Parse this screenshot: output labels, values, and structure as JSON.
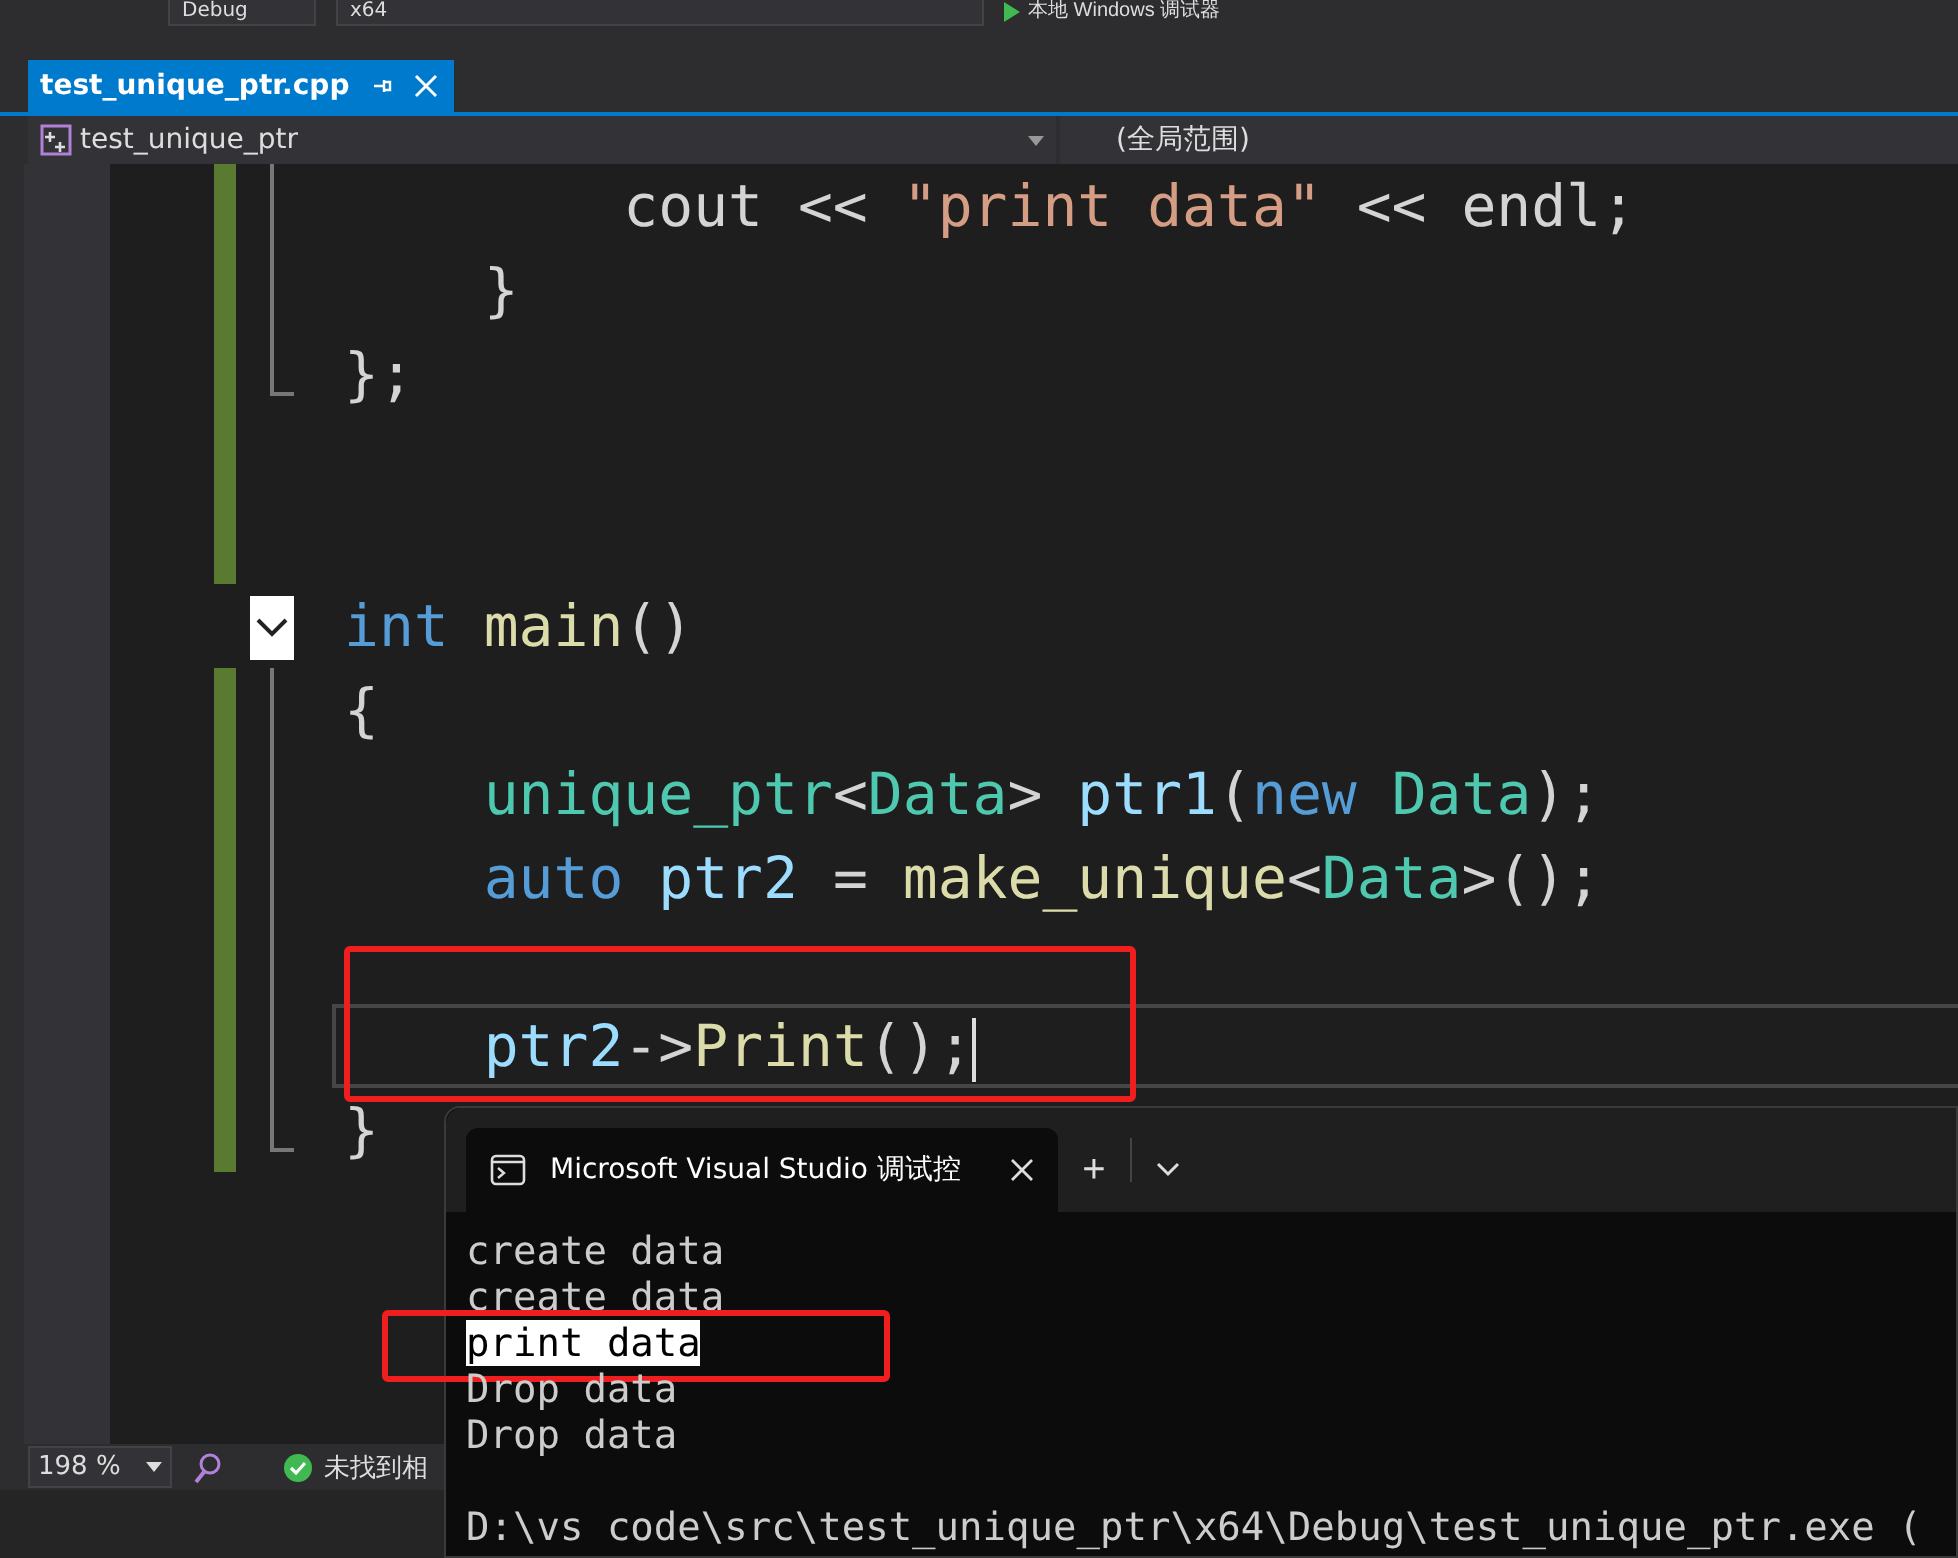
{
  "toolbar": {
    "items": [
      {
        "kind": "combo",
        "label": "Debug"
      },
      {
        "kind": "combo",
        "label": "x64"
      },
      {
        "kind": "run",
        "label": "本地 Windows 调试器"
      }
    ]
  },
  "tabs": [
    {
      "label": "test_unique_ptr.cpp",
      "selected": true
    }
  ],
  "nav": {
    "scope": "test_unique_ptr",
    "member": "(全局范围)"
  },
  "code_lines": [
    {
      "kind": "body",
      "changed": true,
      "tokens": [
        {
          "text": "        cout << ",
          "kind": "plain"
        },
        {
          "text": "\"print data\"",
          "kind": "string"
        },
        {
          "text": " << endl;",
          "kind": "plain"
        }
      ]
    },
    {
      "kind": "body",
      "changed": true,
      "tokens": [
        {
          "text": "    }",
          "kind": "plain"
        }
      ]
    },
    {
      "kind": "end",
      "changed": true,
      "tokens": [
        {
          "text": "};",
          "kind": "plain"
        }
      ]
    },
    {
      "kind": "blank",
      "changed": true
    },
    {
      "kind": "blank",
      "changed": true
    },
    {
      "kind": "start",
      "changed": false,
      "expanded": true,
      "tokens": [
        {
          "text": "int ",
          "kind": "keyword"
        },
        {
          "text": "main",
          "kind": "function"
        },
        {
          "text": "()",
          "kind": "plain"
        }
      ]
    },
    {
      "kind": "body",
      "changed": true,
      "tokens": [
        {
          "text": "{",
          "kind": "plain"
        }
      ]
    },
    {
      "kind": "body",
      "changed": true,
      "tokens": [
        {
          "text": "    unique_ptr",
          "kind": "type"
        },
        {
          "text": "<",
          "kind": "plain"
        },
        {
          "text": "Data",
          "kind": "type"
        },
        {
          "text": "> ",
          "kind": "plain"
        },
        {
          "text": "ptr1",
          "kind": "variable"
        },
        {
          "text": "(",
          "kind": "plain"
        },
        {
          "text": "new ",
          "kind": "keyword"
        },
        {
          "text": "Data",
          "kind": "type"
        },
        {
          "text": ");",
          "kind": "plain"
        }
      ]
    },
    {
      "kind": "body",
      "changed": true,
      "tokens": [
        {
          "text": "    auto ",
          "kind": "keyword"
        },
        {
          "text": "ptr2",
          "kind": "variable"
        },
        {
          "text": " = ",
          "kind": "plain"
        },
        {
          "text": "make_unique",
          "kind": "function"
        },
        {
          "text": "<",
          "kind": "plain"
        },
        {
          "text": "Data",
          "kind": "type"
        },
        {
          "text": ">();",
          "kind": "plain"
        }
      ]
    },
    {
      "kind": "body",
      "changed": true
    },
    {
      "kind": "body",
      "changed": true,
      "current": true,
      "circled": true,
      "tokens": [
        {
          "text": "    ptr2",
          "kind": "variable"
        },
        {
          "text": "->",
          "kind": "plain"
        },
        {
          "text": "Print",
          "kind": "function"
        },
        {
          "text": "();",
          "kind": "plain"
        }
      ]
    },
    {
      "kind": "end",
      "changed": true,
      "tokens": [
        {
          "text": "}",
          "kind": "plain"
        }
      ]
    }
  ],
  "status_bar": {
    "zoom": "198 %",
    "message": "未找到相"
  },
  "console": {
    "tab_title": "Microsoft Visual Studio 调试控",
    "new_tab": "+",
    "lines": [
      {
        "text": "create data",
        "selected": false
      },
      {
        "text": "create data",
        "selected": false
      },
      {
        "text": "print data",
        "selected": true,
        "circled": true
      },
      {
        "text": "Drop data",
        "selected": false
      },
      {
        "text": "Drop data",
        "selected": false
      },
      {
        "text": "D:\\vs code\\src\\test_unique_ptr\\x64\\Debug\\test_unique_ptr.exe (",
        "selected": false
      }
    ]
  }
}
